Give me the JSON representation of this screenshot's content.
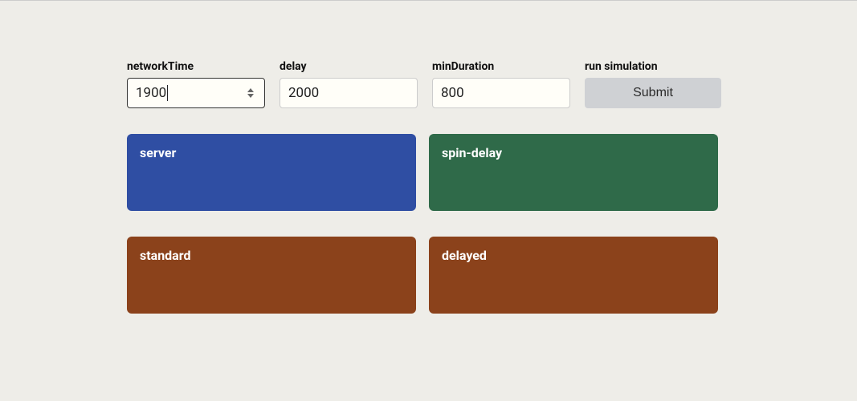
{
  "controls": {
    "networkTime": {
      "label": "networkTime",
      "value": "1900"
    },
    "delay": {
      "label": "delay",
      "value": "2000"
    },
    "minDuration": {
      "label": "minDuration",
      "value": "800"
    },
    "submit": {
      "label": "run simulation",
      "button": "Submit"
    }
  },
  "cards": {
    "server": {
      "title": "server",
      "color": "blue"
    },
    "spinDelay": {
      "title": "spin-delay",
      "color": "green"
    },
    "standard": {
      "title": "standard",
      "color": "brown"
    },
    "delayed": {
      "title": "delayed",
      "color": "brown"
    }
  }
}
